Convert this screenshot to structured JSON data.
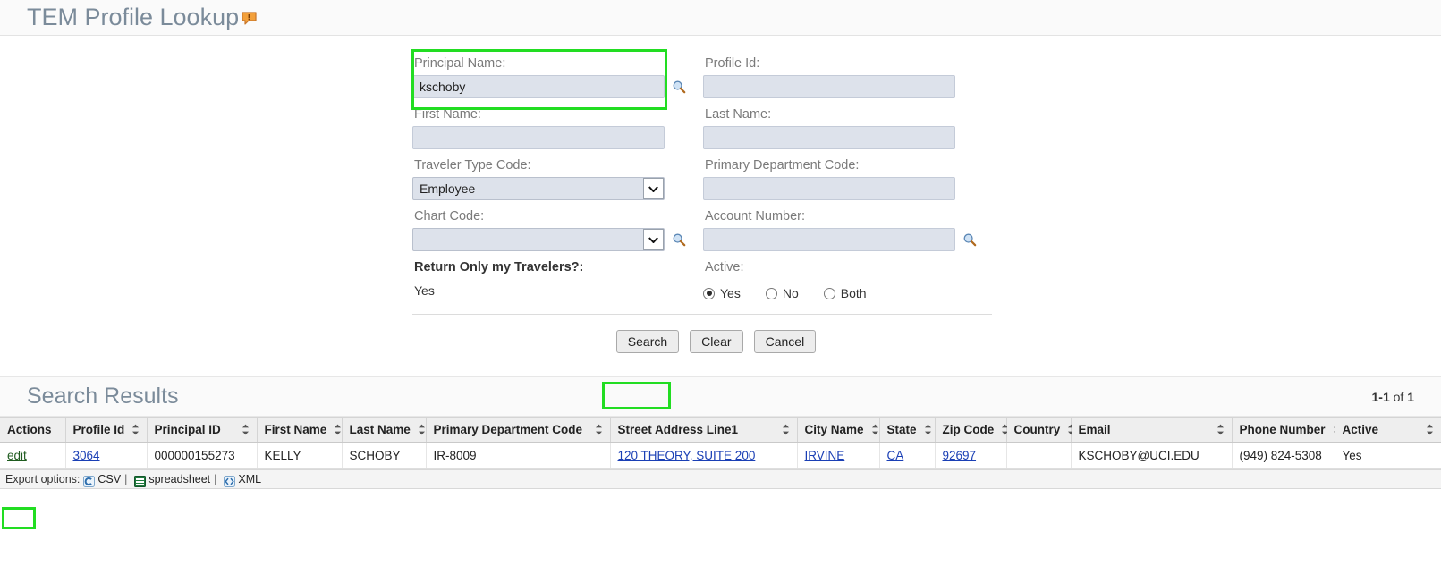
{
  "header": {
    "title": "TEM Profile Lookup",
    "help_icon": "help-bubble-icon"
  },
  "form": {
    "fields": {
      "principal_name": {
        "label": "Principal Name:",
        "value": "kschoby",
        "lookup_icon": "magnifier-icon"
      },
      "profile_id": {
        "label": "Profile Id:",
        "value": ""
      },
      "first_name": {
        "label": "First Name:",
        "value": ""
      },
      "last_name": {
        "label": "Last Name:",
        "value": ""
      },
      "traveler_type_code": {
        "label": "Traveler Type Code:",
        "value": "Employee"
      },
      "primary_department_code": {
        "label": "Primary Department Code:",
        "value": ""
      },
      "chart_code": {
        "label": "Chart Code:",
        "value": "",
        "lookup_icon": "magnifier-icon"
      },
      "account_number": {
        "label": "Account Number:",
        "value": "",
        "lookup_icon": "magnifier-icon"
      },
      "return_only_my_travelers": {
        "label": "Return Only my Travelers?:",
        "value": "Yes"
      },
      "active": {
        "label": "Active:",
        "selected": "Yes",
        "options": [
          "Yes",
          "No",
          "Both"
        ]
      }
    },
    "buttons": {
      "search": "Search",
      "clear": "Clear",
      "cancel": "Cancel"
    }
  },
  "results": {
    "title": "Search Results",
    "count_range": "1-1",
    "count_of": " of ",
    "count_total": "1",
    "columns": [
      {
        "label": "Actions",
        "sortable": false
      },
      {
        "label": "Profile Id",
        "sortable": true
      },
      {
        "label": "Principal ID",
        "sortable": true
      },
      {
        "label": "First Name",
        "sortable": true
      },
      {
        "label": "Last Name",
        "sortable": true
      },
      {
        "label": "Primary Department Code",
        "sortable": true
      },
      {
        "label": "Street Address Line1",
        "sortable": true
      },
      {
        "label": "City Name",
        "sortable": true
      },
      {
        "label": "State",
        "sortable": true
      },
      {
        "label": "Zip Code",
        "sortable": true
      },
      {
        "label": "Country",
        "sortable": true
      },
      {
        "label": "Email",
        "sortable": true
      },
      {
        "label": "Phone Number",
        "sortable": true
      },
      {
        "label": "Active",
        "sortable": true
      }
    ],
    "rows": [
      {
        "actions": "edit",
        "profile_id": "3064",
        "principal_id": "000000155273",
        "first_name": "KELLY",
        "last_name": "SCHOBY",
        "primary_department_code": "IR-8009",
        "street_address_line1": "120 THEORY, SUITE 200",
        "city_name": "IRVINE",
        "state": "CA",
        "zip_code": "92697",
        "country": "",
        "email": "KSCHOBY@UCI.EDU",
        "phone_number": "(949) 824-5308",
        "active": "Yes"
      }
    ]
  },
  "export": {
    "label": "Export options:",
    "csv": "CSV",
    "spreadsheet": "spreadsheet",
    "xml": "XML",
    "separator": "|"
  },
  "highlights": {
    "accent_color": "#22dd22",
    "targets": [
      "principal-name-field",
      "search-button",
      "edit-link"
    ]
  }
}
